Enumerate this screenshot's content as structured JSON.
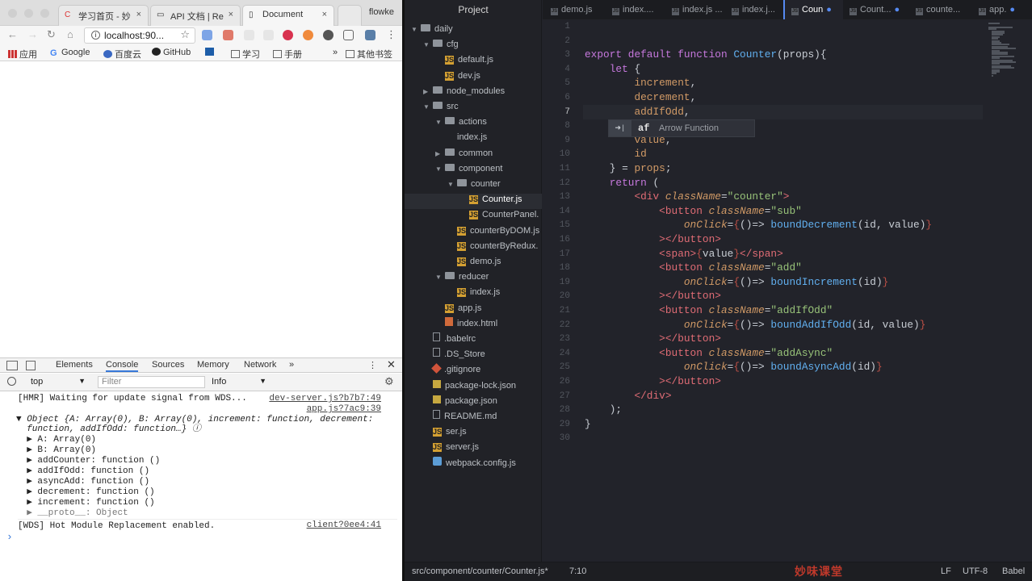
{
  "browser": {
    "tabs": [
      {
        "title": "学习首页 - 妙",
        "close": "×"
      },
      {
        "title": "API 文档 | Re",
        "close": "×"
      },
      {
        "title": "Document",
        "close": "×"
      }
    ],
    "profile": "flowke",
    "url": "localhost:90...",
    "bookmarks": [
      "应用",
      "Google",
      "百度云",
      "GitHub",
      "学习",
      "手册",
      "其他书签"
    ],
    "bookmarks_more": "»"
  },
  "devtools": {
    "tabs": [
      "Elements",
      "Console",
      "Sources",
      "Memory",
      "Network"
    ],
    "more_tabs": "»",
    "context": "top",
    "filter_placeholder": "Filter",
    "level": "Info",
    "logs": [
      {
        "text": "[HMR] Waiting for update signal from WDS...",
        "src": "dev-server.js?b7b7:49"
      },
      {
        "text": "",
        "src": "app.js?7ac9:39"
      },
      {
        "text": "▼ Object {A: Array(0), B: Array(0), increment: function, decrement:",
        "src": ""
      },
      {
        "text": "  function, addIfOdd: function…} ⓘ",
        "src": ""
      },
      {
        "text": "  ▶ A: Array(0)",
        "src": ""
      },
      {
        "text": "  ▶ B: Array(0)",
        "src": ""
      },
      {
        "text": "  ▶ addCounter: function ()",
        "src": ""
      },
      {
        "text": "  ▶ addIfOdd: function ()",
        "src": ""
      },
      {
        "text": "  ▶ asyncAdd: function ()",
        "src": ""
      },
      {
        "text": "  ▶ decrement: function ()",
        "src": ""
      },
      {
        "text": "  ▶ increment: function ()",
        "src": ""
      },
      {
        "text": "  ▶ __proto__: Object",
        "src": ""
      },
      {
        "text": "[WDS] Hot Module Replacement enabled.",
        "src": "client?0ee4:41"
      }
    ],
    "prompt": "›"
  },
  "editor": {
    "project_title": "Project",
    "tabs": [
      "demo.js",
      "index....",
      "index.js ...",
      "index.j...",
      "Coun",
      "Count...",
      "counte...",
      "app."
    ],
    "tree": [
      {
        "label": "daily",
        "depth": 0,
        "kind": "folder",
        "arrow": "▼"
      },
      {
        "label": "cfg",
        "depth": 1,
        "kind": "folder",
        "arrow": "▼"
      },
      {
        "label": "default.js",
        "depth": 2,
        "kind": "js",
        "arrow": ""
      },
      {
        "label": "dev.js",
        "depth": 2,
        "kind": "js",
        "arrow": ""
      },
      {
        "label": "node_modules",
        "depth": 1,
        "kind": "folder",
        "arrow": "▶"
      },
      {
        "label": "src",
        "depth": 1,
        "kind": "folder",
        "arrow": "▼"
      },
      {
        "label": "actions",
        "depth": 2,
        "kind": "folder",
        "arrow": "▼"
      },
      {
        "label": "index.js",
        "depth": 3,
        "kind": "plain",
        "arrow": ""
      },
      {
        "label": "common",
        "depth": 2,
        "kind": "folder",
        "arrow": "▶"
      },
      {
        "label": "component",
        "depth": 2,
        "kind": "folder",
        "arrow": "▼"
      },
      {
        "label": "counter",
        "depth": 3,
        "kind": "folder",
        "arrow": "▼"
      },
      {
        "label": "Counter.js",
        "depth": 4,
        "kind": "js",
        "arrow": ""
      },
      {
        "label": "CounterPanel.",
        "depth": 4,
        "kind": "js",
        "arrow": ""
      },
      {
        "label": "counterByDOM.js",
        "depth": 3,
        "kind": "js",
        "arrow": ""
      },
      {
        "label": "counterByRedux.",
        "depth": 3,
        "kind": "js",
        "arrow": ""
      },
      {
        "label": "demo.js",
        "depth": 3,
        "kind": "js",
        "arrow": ""
      },
      {
        "label": "reducer",
        "depth": 2,
        "kind": "folder",
        "arrow": "▼"
      },
      {
        "label": "index.js",
        "depth": 3,
        "kind": "js",
        "arrow": ""
      },
      {
        "label": "app.js",
        "depth": 2,
        "kind": "js",
        "arrow": ""
      },
      {
        "label": "index.html",
        "depth": 2,
        "kind": "html5",
        "arrow": ""
      },
      {
        "label": ".babelrc",
        "depth": 1,
        "kind": "file",
        "arrow": ""
      },
      {
        "label": ".DS_Store",
        "depth": 1,
        "kind": "file",
        "arrow": ""
      },
      {
        "label": ".gitignore",
        "depth": 1,
        "kind": "git",
        "arrow": ""
      },
      {
        "label": "package-lock.json",
        "depth": 1,
        "kind": "json",
        "arrow": ""
      },
      {
        "label": "package.json",
        "depth": 1,
        "kind": "json",
        "arrow": ""
      },
      {
        "label": "README.md",
        "depth": 1,
        "kind": "file",
        "arrow": ""
      },
      {
        "label": "ser.js",
        "depth": 1,
        "kind": "js",
        "arrow": ""
      },
      {
        "label": "server.js",
        "depth": 1,
        "kind": "js",
        "arrow": ""
      },
      {
        "label": "webpack.config.js",
        "depth": 1,
        "kind": "wp",
        "arrow": ""
      }
    ],
    "line_numbers": [
      "1",
      "2",
      "3",
      "4",
      "5",
      "6",
      "7",
      "8",
      "9",
      "10",
      "11",
      "12",
      "13",
      "14",
      "15",
      "16",
      "17",
      "18",
      "19",
      "20",
      "21",
      "22",
      "23",
      "24",
      "25",
      "26",
      "27",
      "28",
      "29",
      "30"
    ],
    "autocomplete": {
      "badge": "➜|",
      "text": "af",
      "desc": "Arrow Function"
    },
    "status": {
      "path": "src/component/counter/Counter.js*",
      "cursor": "7:10",
      "watermark": "妙味课堂",
      "line_ending": "LF",
      "encoding": "UTF-8",
      "grammar": "Babel"
    }
  }
}
